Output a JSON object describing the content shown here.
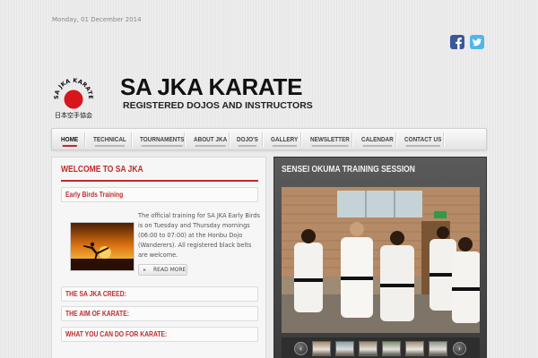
{
  "header": {
    "date": "Monday, 01 December 2014",
    "title": "SA JKA KARATE",
    "subtitle": "REGISTERED DOJOS AND INSTRUCTORS",
    "logo_text_top": "SA JKA KARATE",
    "logo_text_bottom": "日本空手協会"
  },
  "social": {
    "facebook_icon": "facebook-icon",
    "twitter_icon": "twitter-icon"
  },
  "nav": {
    "items": [
      {
        "label": "HOME",
        "active": true
      },
      {
        "label": "TECHNICAL"
      },
      {
        "label": "TOURNAMENTS"
      },
      {
        "label": "ABOUT JKA"
      },
      {
        "label": "DOJO'S"
      },
      {
        "label": "GALLERY"
      },
      {
        "label": "NEWSLETTER"
      },
      {
        "label": "CALENDAR"
      },
      {
        "label": "CONTACT US"
      }
    ]
  },
  "left": {
    "heading": "WELCOME TO SA JKA",
    "article_title": "Early Birds Training",
    "article_text": "The official training for SA JKA Early Birds is on Tuesday and Thursday mornings (06:00 to 07:00) at the Honbu Dojo (Wanderers). All registered black belts are welcome.",
    "read_more": "READ MORE",
    "sections": [
      "THE SA JKA CREED:",
      "THE AIM OF KARATE:",
      "WHAT YOU CAN DO FOR KARATE:"
    ]
  },
  "right": {
    "heading": "SENSEI OKUMA TRAINING SESSION",
    "prev_label": "‹",
    "next_label": "›"
  },
  "colors": {
    "accent": "#c0292b",
    "panel_dark": "#4a4a4a"
  }
}
